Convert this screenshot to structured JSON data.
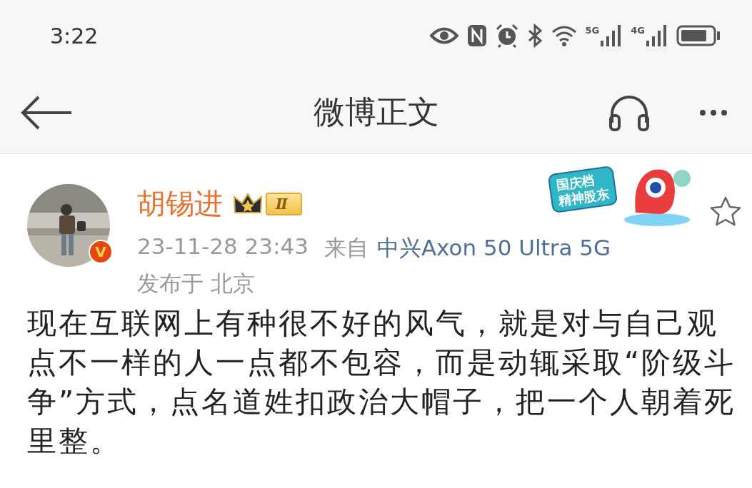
{
  "status_bar": {
    "time": "3:22",
    "network_1": "5G",
    "network_2": "4G"
  },
  "nav_bar": {
    "title": "微博正文"
  },
  "post": {
    "author": "胡锡进",
    "member_level": "Ⅱ",
    "verified_mark": "V",
    "time": "23-11-28 23:43",
    "source_prefix": "来自",
    "source": "中兴Axon 50 Ultra 5G",
    "location": "发布于 北京",
    "sticker": {
      "line_1": "国庆档",
      "line_2": "精神股东"
    },
    "text": "现在互联网上有种很不好的风气，就是对与自己观点不一样的人一点都不包容，而是动辄采取“阶级斗争”方式，点名道姓扣政治大帽子，把一个人朝着死里整。"
  }
}
